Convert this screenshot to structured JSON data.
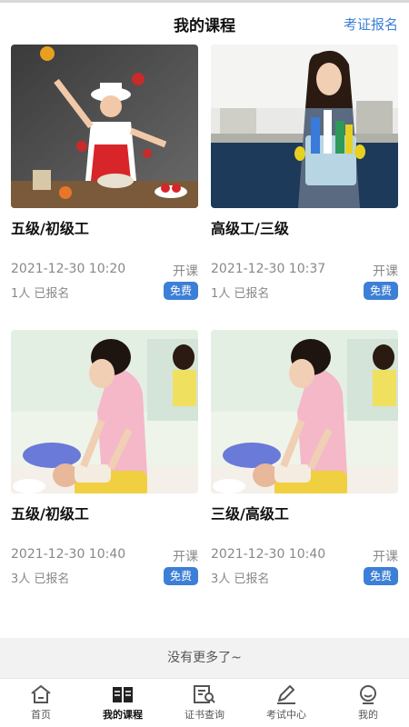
{
  "header": {
    "title": "我的课程",
    "action": "考证报名"
  },
  "courses": [
    {
      "name": "五级/初级工",
      "time": "2021-12-30 10:20",
      "status": "开课",
      "enrolled": "1人 已报名",
      "badge": "免费"
    },
    {
      "name": "高级工/三级",
      "time": "2021-12-30 10:37",
      "status": "开课",
      "enrolled": "1人 已报名",
      "badge": "免费"
    },
    {
      "name": "五级/初级工",
      "time": "2021-12-30 10:40",
      "status": "开课",
      "enrolled": "3人 已报名",
      "badge": "免费"
    },
    {
      "name": "三级/高级工",
      "time": "2021-12-30 10:40",
      "status": "开课",
      "enrolled": "3人 已报名",
      "badge": "免费"
    }
  ],
  "footer_note": "没有更多了~",
  "tabs": [
    {
      "label": "首页",
      "icon": "home-icon"
    },
    {
      "label": "我的课程",
      "icon": "book-icon"
    },
    {
      "label": "证书查询",
      "icon": "certificate-search-icon"
    },
    {
      "label": "考试中心",
      "icon": "pencil-icon"
    },
    {
      "label": "我的",
      "icon": "profile-icon"
    }
  ],
  "colors": {
    "accent": "#3d7fd6",
    "muted": "#888888",
    "footer_bg": "#f2f2f2"
  }
}
